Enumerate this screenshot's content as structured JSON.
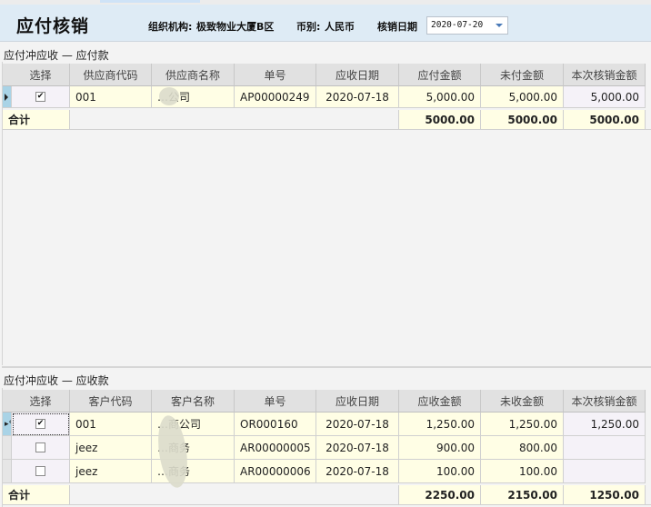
{
  "header": {
    "title": "应付核销",
    "org_label": "组织机构:",
    "org_value": "极致物业大厦B区",
    "currency_label": "币别:",
    "currency_value": "人民币",
    "date_label": "核销日期",
    "date_value": "2020-07-20"
  },
  "payable": {
    "section_title": "应付冲应收 — 应付款",
    "columns": [
      "选择",
      "供应商代码",
      "供应商名称",
      "单号",
      "应收日期",
      "应付金额",
      "未付金额",
      "本次核销金额"
    ],
    "rows": [
      {
        "selected": true,
        "code": "001",
        "name": "…公司",
        "doc_no": "AP00000249",
        "date": "2020-07-18",
        "amount": "5,000.00",
        "unpaid": "5,000.00",
        "writeoff": "5,000.00"
      }
    ],
    "total_label": "合计",
    "totals": {
      "amount": "5000.00",
      "unpaid": "5000.00",
      "writeoff": "5000.00"
    }
  },
  "receivable": {
    "section_title": "应付冲应收 — 应收款",
    "columns": [
      "选择",
      "客户代码",
      "客户名称",
      "单号",
      "应收日期",
      "应收金额",
      "未收金额",
      "本次核销金额"
    ],
    "rows": [
      {
        "selected": true,
        "code": "001",
        "name": "…商公司",
        "doc_no": "OR000160",
        "date": "2020-07-18",
        "amount": "1,250.00",
        "unpaid": "1,250.00",
        "writeoff": "1,250.00"
      },
      {
        "selected": false,
        "code": "jeez",
        "name": "…商务",
        "doc_no": "AR00000005",
        "date": "2020-07-18",
        "amount": "900.00",
        "unpaid": "800.00",
        "writeoff": ""
      },
      {
        "selected": false,
        "code": "jeez",
        "name": "…商务",
        "doc_no": "AR00000006",
        "date": "2020-07-18",
        "amount": "100.00",
        "unpaid": "100.00",
        "writeoff": ""
      }
    ],
    "total_label": "合计",
    "totals": {
      "amount": "2250.00",
      "unpaid": "2150.00",
      "writeoff": "1250.00"
    }
  }
}
